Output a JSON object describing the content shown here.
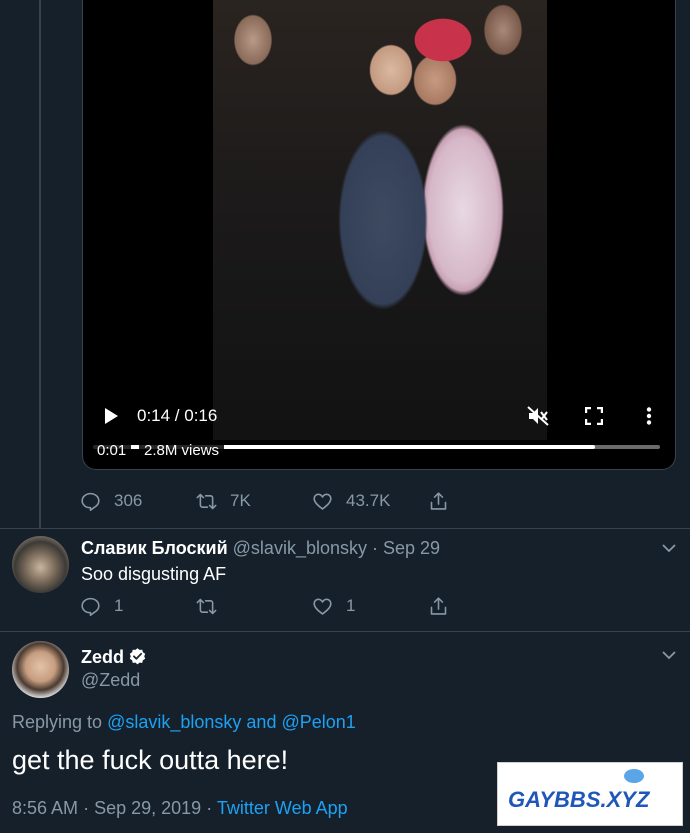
{
  "video": {
    "time": "0:14 / 0:16",
    "elapsed": "0:01",
    "views": "2.8M views",
    "progress_fraction": 0.885
  },
  "main_tweet_actions": {
    "replies": "306",
    "retweets": "7K",
    "likes": "43.7K"
  },
  "reply": {
    "display_name": "Славик Блоский",
    "handle": "@slavik_blonsky",
    "separator": "·",
    "date": "Sep 29",
    "text": "Soo disgusting AF",
    "replies": "1",
    "retweets": "",
    "likes": "1"
  },
  "focus_tweet": {
    "display_name": "Zedd",
    "handle": "@Zedd",
    "replying_prefix": "Replying to",
    "replying_to_1": "@slavik_blonsky",
    "replying_and": "and",
    "replying_to_2": "@Pelon1",
    "text": "get the fuck outta here!",
    "time": "8:56 AM",
    "separator": "·",
    "date": "Sep 29, 2019",
    "source": "Twitter Web App"
  },
  "watermark": {
    "text": "GAYBBS.XYZ"
  },
  "colors": {
    "background": "#15202b",
    "secondary_text": "#8899a6",
    "link": "#1da1f2",
    "divider": "#38444d"
  }
}
